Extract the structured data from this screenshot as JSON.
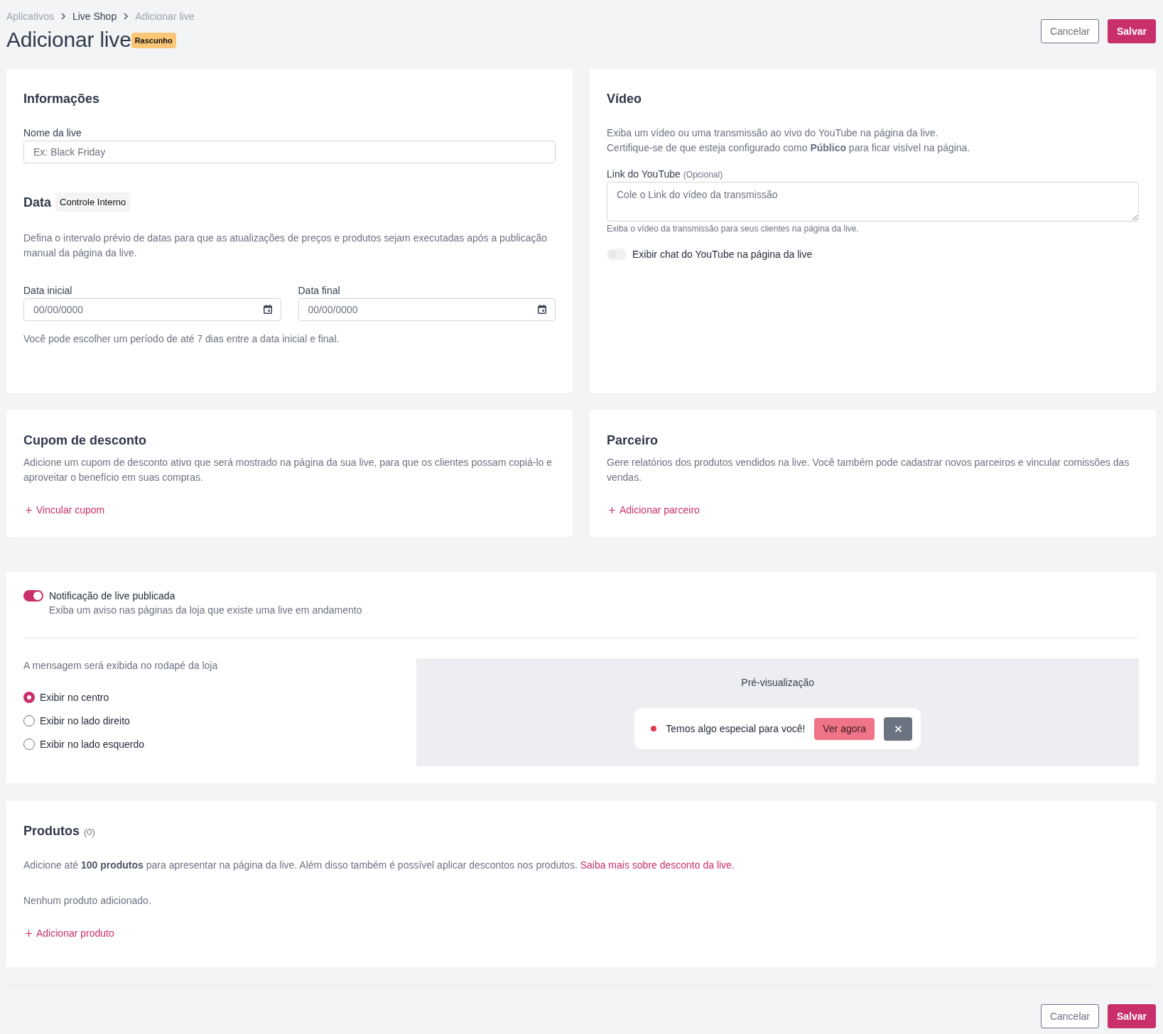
{
  "breadcrumb": [
    {
      "label": "Aplicativos",
      "highlighted": false
    },
    {
      "label": "Live Shop",
      "highlighted": true
    },
    {
      "label": "Adicionar live",
      "highlighted": false
    }
  ],
  "page": {
    "title": "Adicionar live",
    "badge": "Rascunho"
  },
  "top_actions": [
    {
      "label": "Cancelar",
      "kind": "secondary"
    },
    {
      "label": "Salvar",
      "kind": "primary"
    }
  ],
  "info_card": {
    "title": "Informações",
    "name_field": {
      "label": "Nome da live",
      "placeholder": "Ex: Black Friday"
    },
    "date_section": {
      "title": "Data",
      "tag": "Controle Interno",
      "description": "Defina o intervalo prévio de datas para que as atualizações de preços e produtos sejam executadas após a publicação manual da página da live.",
      "fields": [
        {
          "label": "Data inicial",
          "placeholder": "00/00/0000"
        },
        {
          "label": "Data final",
          "placeholder": "00/00/0000"
        }
      ],
      "hint": "Você pode escolher um período de até 7 dias entre a data inicial e final."
    }
  },
  "video_card": {
    "title": "Vídeo",
    "description": [
      "Exiba um vídeo ou uma transmissão ao vivo do YouTube na página da live.",
      "Certifique-se de que esteja configurado como **Público** para ficar visível na página."
    ],
    "link_field": {
      "label": "Link do YouTube",
      "optional": "(Opcional)",
      "placeholder": "Cole o Link do vídeo da transmissão",
      "hint": "Exiba o vídeo da transmissão para seus clientes na página da live."
    },
    "chat_toggle": {
      "label": "Exibir chat do YouTube na página da live",
      "on": false
    }
  },
  "coupon_card": {
    "title": "Cupom de desconto",
    "description": "Adicione um cupom de desconto ativo que será mostrado na página da sua live, para que os clientes possam copiá-lo e aproveitar o benefício em suas compras.",
    "action": "Vincular cupom"
  },
  "partner_card": {
    "title": "Parceiro",
    "description": "Gere relatórios dos produtos vendidos na live. Você também pode cadastrar novos parceiros e vincular comissões das vendas.",
    "action": "Adicionar parceiro"
  },
  "notification_card": {
    "toggle": {
      "title": "Notificação de live publicada",
      "description": "Exiba um aviso nas páginas da loja que existe uma live em andamento",
      "on": true
    },
    "position": {
      "label": "A mensagem será exibida no rodapé da loja",
      "options": [
        {
          "label": "Exibir no centro",
          "selected": true
        },
        {
          "label": "Exibir no lado direito",
          "selected": false
        },
        {
          "label": "Exibir no lado esquerdo",
          "selected": false
        }
      ]
    },
    "preview": {
      "title": "Pré-visualização",
      "message": "Temos algo especial para você!",
      "button": "Ver agora"
    }
  },
  "products_card": {
    "title": "Produtos",
    "count": "(0)",
    "description": "Adicione até **100 produtos** para apresentar na página da live. Além disso também é possível aplicar descontos nos produtos.",
    "link": "Saiba mais sobre desconto da live.",
    "empty": "Nenhum produto adicionado.",
    "action": "Adicionar produto"
  },
  "bottom_actions": [
    {
      "label": "Cancelar",
      "kind": "secondary"
    },
    {
      "label": "Salvar",
      "kind": "primary"
    }
  ]
}
